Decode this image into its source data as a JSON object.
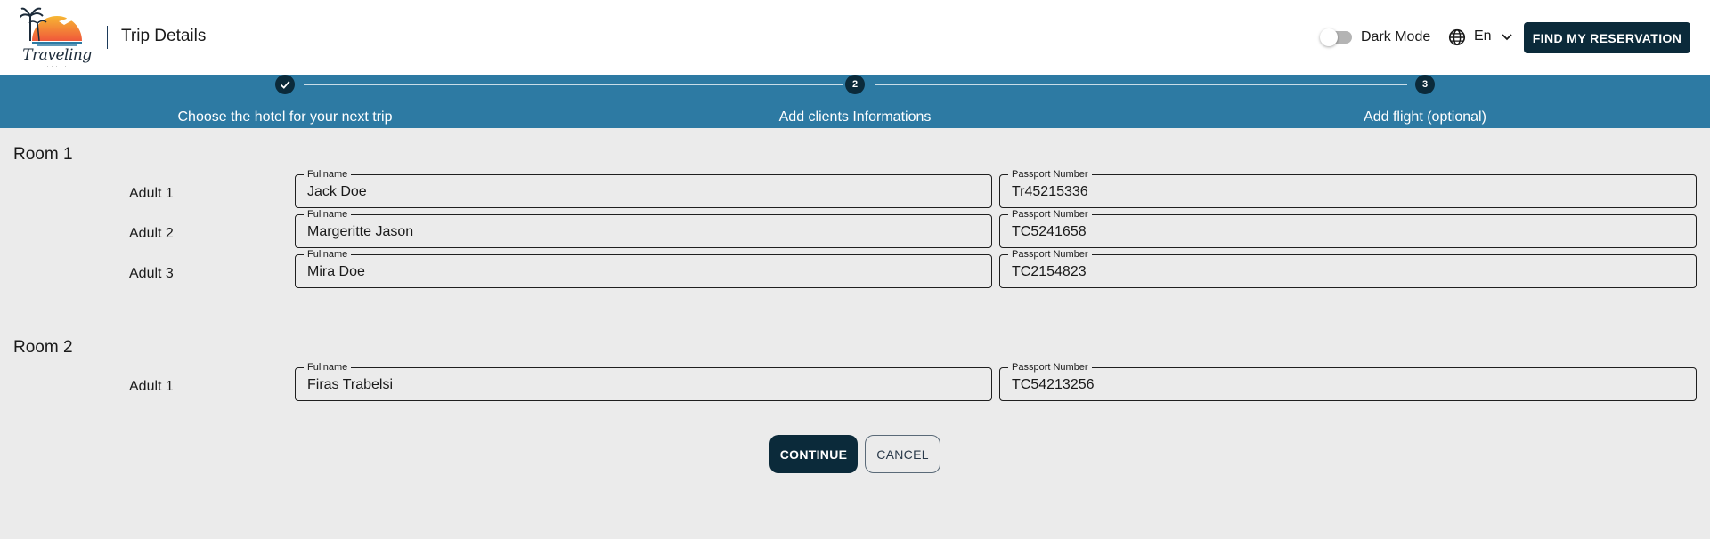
{
  "header": {
    "logo_text": "Traveling",
    "logo_subtext": "· · · · ·",
    "page_title": "Trip Details",
    "dark_mode_label": "Dark Mode",
    "dark_mode_on": false,
    "language": "En",
    "find_button": "FIND MY RESERVATION",
    "icons": [
      "logo",
      "globe-icon",
      "chevron-down-icon"
    ],
    "colors": {
      "primary": "#0b2a3a",
      "stepper_bg": "#2d7aa3",
      "page_bg": "#ebebeb"
    }
  },
  "stepper": {
    "steps": [
      {
        "label": "Choose the hotel for your next trip",
        "status": "completed",
        "number": ""
      },
      {
        "label": "Add clients Informations",
        "status": "active",
        "number": "2"
      },
      {
        "label": "Add flight (optional)",
        "status": "pending",
        "number": "3"
      }
    ]
  },
  "rooms": [
    {
      "title": "Room 1",
      "adults": [
        {
          "label": "Adult 1",
          "fullname_label": "Fullname",
          "fullname": "Jack Doe",
          "passport_label": "Passport Number",
          "passport": "Tr45215336"
        },
        {
          "label": "Adult 2",
          "fullname_label": "Fullname",
          "fullname": "Margeritte Jason",
          "passport_label": "Passport Number",
          "passport": "TC5241658"
        },
        {
          "label": "Adult 3",
          "fullname_label": "Fullname",
          "fullname": "Mira Doe",
          "passport_label": "Passport Number",
          "passport": "TC2154823"
        }
      ]
    },
    {
      "title": "Room 2",
      "adults": [
        {
          "label": "Adult 1",
          "fullname_label": "Fullname",
          "fullname": "Firas Trabelsi",
          "passport_label": "Passport Number",
          "passport": "TC54213256"
        }
      ]
    }
  ],
  "actions": {
    "continue": "CONTINUE",
    "cancel": "CANCEL"
  }
}
